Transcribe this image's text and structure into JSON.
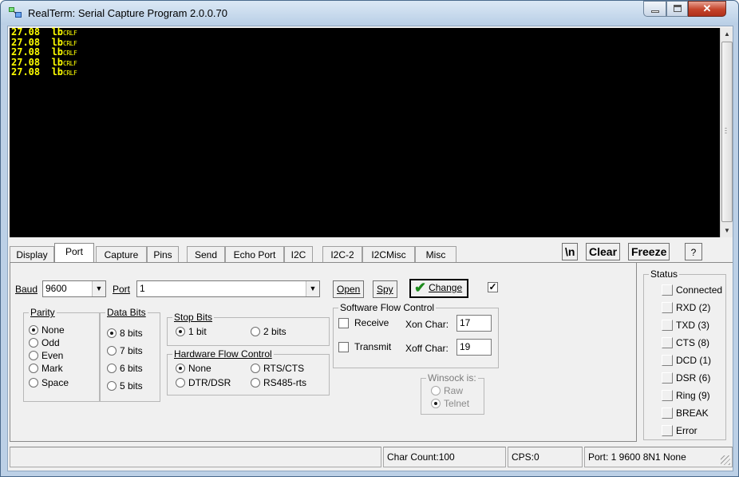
{
  "window": {
    "title": "RealTerm: Serial Capture Program 2.0.0.70",
    "controls": {
      "minimize": "minimize-icon",
      "maximize": "maximize-icon",
      "close": "✕"
    }
  },
  "terminal": {
    "lines": [
      {
        "value": "27.08  lb",
        "suffix": "CRLF"
      },
      {
        "value": "27.08  lb",
        "suffix": "CRLF"
      },
      {
        "value": "27.08  lb",
        "suffix": "CRLF"
      },
      {
        "value": "27.08  lb",
        "suffix": "CRLF"
      },
      {
        "value": "27.08  lb",
        "suffix": "CRLF"
      }
    ],
    "fg_color": "#ffff00",
    "bg_color": "#000000"
  },
  "tabs": [
    {
      "label": "Display",
      "active": false
    },
    {
      "label": "Port",
      "active": true
    },
    {
      "label": "Capture",
      "active": false
    },
    {
      "label": "Pins",
      "active": false
    },
    {
      "label": "Send",
      "active": false
    },
    {
      "label": "Echo Port",
      "active": false
    },
    {
      "label": "I2C",
      "active": false
    },
    {
      "label": "I2C-2",
      "active": false
    },
    {
      "label": "I2CMisc",
      "active": false
    },
    {
      "label": "Misc",
      "active": false
    }
  ],
  "toolbar": {
    "newline": "\\n",
    "clear": "Clear",
    "freeze": "Freeze",
    "help": "?"
  },
  "port": {
    "baud_label": "Baud",
    "baud_value": "9600",
    "port_label": "Port",
    "port_value": "1",
    "open_label": "Open",
    "spy_label": "Spy",
    "change_label": "Change",
    "change_checked": true,
    "parity": {
      "title": "Parity",
      "options": [
        "None",
        "Odd",
        "Even",
        "Mark",
        "Space"
      ],
      "selected": "None"
    },
    "data_bits": {
      "title": "Data Bits",
      "options": [
        "8 bits",
        "7 bits",
        "6 bits",
        "5 bits"
      ],
      "selected": "8 bits"
    },
    "stop_bits": {
      "title": "Stop Bits",
      "options": [
        "1 bit",
        "2 bits"
      ],
      "selected": "1 bit"
    },
    "hw_flow": {
      "title": "Hardware Flow Control",
      "options": [
        "None",
        "RTS/CTS",
        "DTR/DSR",
        "RS485-rts"
      ],
      "selected": "None"
    },
    "sw_flow": {
      "title": "Software Flow Control",
      "receive_label": "Receive",
      "transmit_label": "Transmit",
      "xon_label": "Xon Char:",
      "xon_value": "17",
      "xoff_label": "Xoff Char:",
      "xoff_value": "19"
    },
    "winsock": {
      "title": "Winsock is:",
      "options": [
        "Raw",
        "Telnet"
      ],
      "selected": "Telnet"
    }
  },
  "status": {
    "title": "Status",
    "items": [
      "Connected",
      "RXD (2)",
      "TXD (3)",
      "CTS (8)",
      "DCD (1)",
      "DSR (6)",
      "Ring (9)",
      "BREAK",
      "Error"
    ]
  },
  "statusbar": {
    "char_count": "Char Count:100",
    "cps": "CPS:0",
    "port_info": "Port: 1 9600 8N1 None"
  }
}
